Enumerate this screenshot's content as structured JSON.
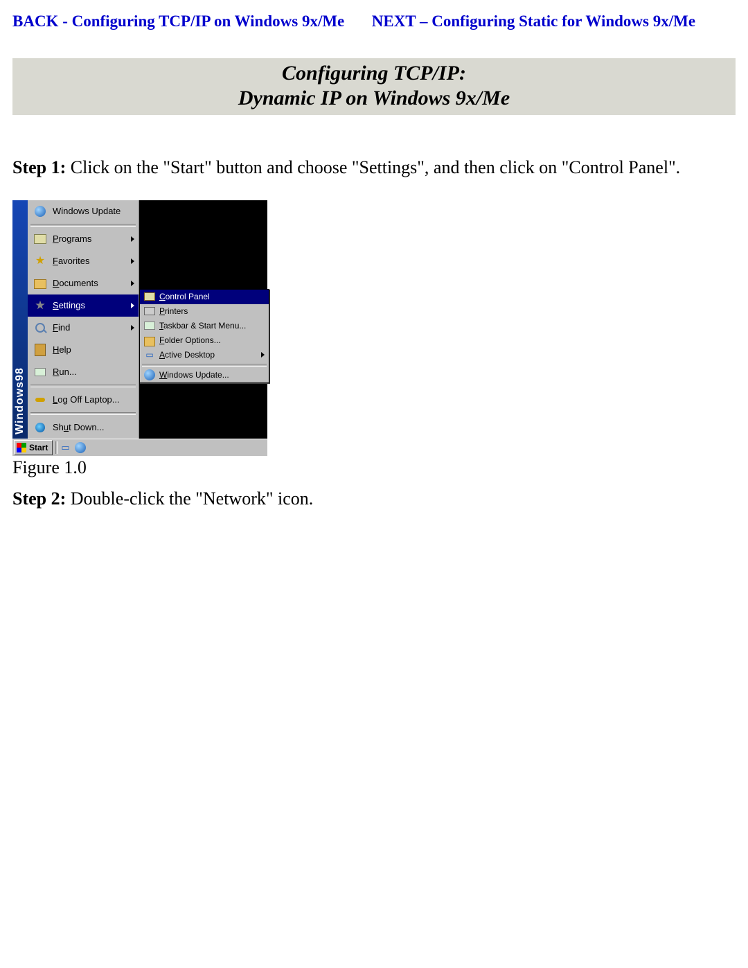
{
  "nav": {
    "back_label": "BACK - Configuring TCP/IP on Windows 9x/Me",
    "next_label": "NEXT – Configuring Static for Windows 9x/Me"
  },
  "title": {
    "line1": "Configuring TCP/IP:",
    "line2": "Dynamic IP on Windows 9x/Me"
  },
  "step1": {
    "label": "Step 1:",
    "text": " Click on the \"Start\" button and choose \"Settings\", and then click on \"Control Panel\"."
  },
  "figure_caption": "Figure 1.0",
  "step2": {
    "label": "Step 2:",
    "text": "  Double-click the \"Network\" icon."
  },
  "screenshot": {
    "banner": "Windows98",
    "start_menu": [
      {
        "icon": "globe",
        "label": "Windows Update",
        "arrow": false,
        "sep_after": true
      },
      {
        "icon": "prog",
        "label": "Programs",
        "underline": "P",
        "arrow": true
      },
      {
        "icon": "star",
        "label": "Favorites",
        "underline": "F",
        "arrow": true
      },
      {
        "icon": "folder",
        "label": "Documents",
        "underline": "D",
        "arrow": true
      },
      {
        "icon": "set",
        "label": "Settings",
        "underline": "S",
        "arrow": true,
        "highlight": true
      },
      {
        "icon": "mag",
        "label": "Find",
        "underline": "F",
        "arrow": true
      },
      {
        "icon": "book",
        "label": "Help",
        "underline": "H",
        "arrow": false
      },
      {
        "icon": "run",
        "label": "Run...",
        "underline": "R",
        "arrow": false,
        "sep_after": true
      },
      {
        "icon": "key",
        "label": "Log Off Laptop...",
        "underline": "L",
        "arrow": false,
        "sep_after": true
      },
      {
        "icon": "shut",
        "label": "Shut Down...",
        "underline": "u",
        "arrow": false
      }
    ],
    "submenu": [
      {
        "icon": "cp",
        "label": "Control Panel",
        "underline": "C",
        "highlight": true
      },
      {
        "icon": "printer",
        "label": "Printers",
        "underline": "P"
      },
      {
        "icon": "run",
        "label": "Taskbar & Start Menu...",
        "underline": "T"
      },
      {
        "icon": "folder",
        "label": "Folder Options...",
        "underline": "F"
      },
      {
        "icon": "desk",
        "label": "Active Desktop",
        "underline": "A",
        "arrow": true,
        "sep_after": true
      },
      {
        "icon": "globe",
        "label": "Windows Update...",
        "underline": "W"
      }
    ],
    "taskbar": {
      "start_label": "Start"
    }
  }
}
